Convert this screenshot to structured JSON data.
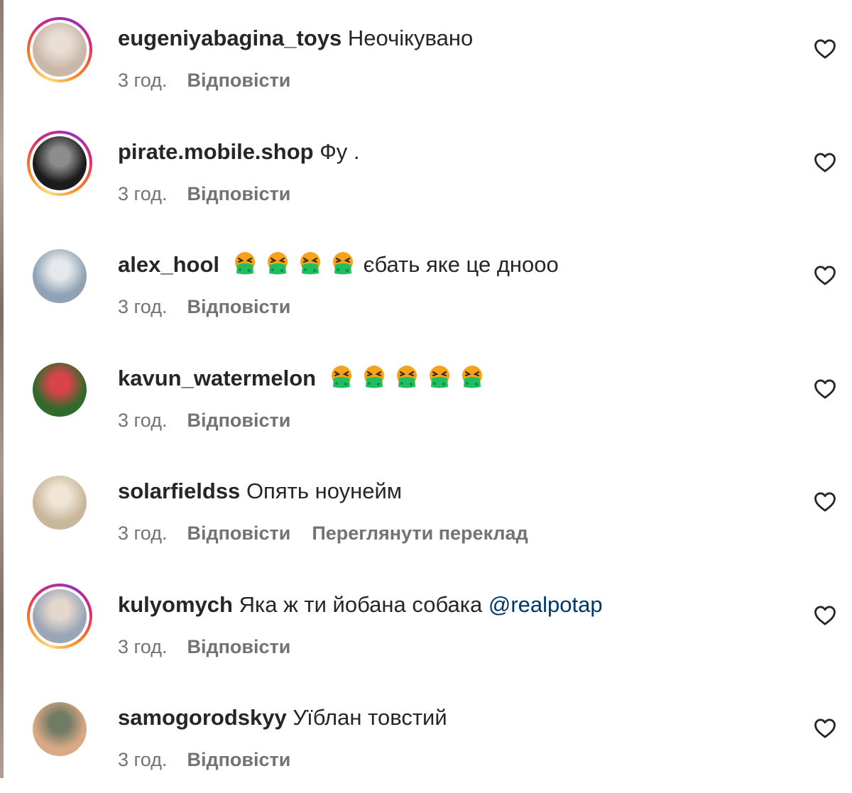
{
  "comments": [
    {
      "username": "eugeniyabagina_toys",
      "text": "Неочікувано",
      "emoji_count": 0,
      "mention": "",
      "time": "3 год.",
      "reply_label": "Відповісти",
      "translate_label": "",
      "story_ring": true,
      "avatar_colors": [
        "#c9b8a8",
        "#e9ded4"
      ]
    },
    {
      "username": "pirate.mobile.shop",
      "text": "Фу .",
      "emoji_count": 0,
      "mention": "",
      "time": "3 год.",
      "reply_label": "Відповісти",
      "translate_label": "",
      "story_ring": true,
      "avatar_colors": [
        "#1c1c1c",
        "#8d8d8d"
      ]
    },
    {
      "username": "alex_hool",
      "text": "єбать яке це дноoo",
      "emoji_count": 4,
      "mention": "",
      "time": "3 год.",
      "reply_label": "Відповісти",
      "translate_label": "",
      "story_ring": false,
      "avatar_colors": [
        "#8fa3b5",
        "#e6e9ec"
      ]
    },
    {
      "username": "kavun_watermelon",
      "text": "",
      "emoji_count": 5,
      "mention": "",
      "time": "3 год.",
      "reply_label": "Відповісти",
      "translate_label": "",
      "story_ring": false,
      "avatar_colors": [
        "#2f6b2a",
        "#d9434a"
      ]
    },
    {
      "username": "solarfieldss",
      "text": "Опять ноунейм",
      "emoji_count": 0,
      "mention": "",
      "time": "3 год.",
      "reply_label": "Відповісти",
      "translate_label": "Переглянути переклад",
      "story_ring": false,
      "avatar_colors": [
        "#c9b79b",
        "#efe6d6"
      ]
    },
    {
      "username": "kulyomych",
      "text": "Яка ж ти йобана собака",
      "emoji_count": 0,
      "mention": "@realpotap",
      "time": "3 год.",
      "reply_label": "Відповісти",
      "translate_label": "",
      "story_ring": true,
      "avatar_colors": [
        "#9aa6b8",
        "#e4d7cb"
      ]
    },
    {
      "username": "samogorodskyy",
      "text": "Уїблан товстий",
      "emoji_count": 0,
      "mention": "",
      "time": "3 год.",
      "reply_label": "Відповісти",
      "translate_label": "",
      "story_ring": false,
      "avatar_colors": [
        "#d9a886",
        "#6f7b63"
      ]
    }
  ],
  "colors": {
    "text": "#262626",
    "secondary": "#737373",
    "mention": "#00376b",
    "emoji_face": "#f7a21b",
    "emoji_mask": "#1fbf5f"
  },
  "icons": {
    "like": "heart-outline-icon",
    "emoji": "face-vomiting-emoji"
  }
}
